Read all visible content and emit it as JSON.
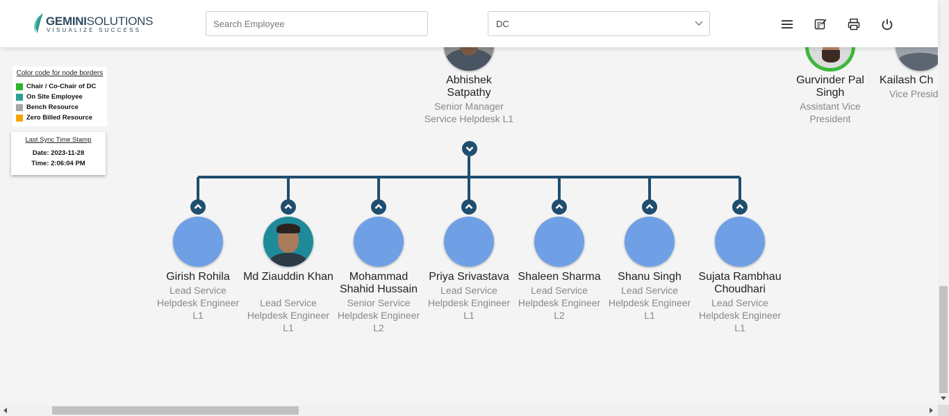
{
  "header": {
    "logo_brand": "GEMINI",
    "logo_suffix": "SOLUTIONS",
    "logo_tagline": "VISUALIZE SUCCESS",
    "search_placeholder": "Search Employee",
    "department_value": "DC",
    "icons": [
      "menu-icon",
      "notes-icon",
      "print-icon",
      "power-icon"
    ]
  },
  "legend": {
    "title": "Color code for node borders",
    "items": [
      {
        "label": "Chair / Co-Chair of DC",
        "color": "#2db52d"
      },
      {
        "label": "On Site Employee",
        "color": "#2f9f9a"
      },
      {
        "label": "Bench Resource",
        "color": "#a6a6a6"
      },
      {
        "label": "Zero Billed Resource",
        "color": "#f5a300"
      }
    ]
  },
  "sync": {
    "title": "Last Sync Time Stamp",
    "date": "Date: 2023-11-28",
    "time": "Time: 2:06:04 PM"
  },
  "org": {
    "colors": {
      "connector": "#1f4e6e",
      "avatar_default": "#6fa0e6",
      "chair_border": "#3cb83c"
    },
    "top_nodes": [
      {
        "name": "Abhishek Satpathy",
        "title": "Senior Manager Service Helpdesk L1"
      },
      {
        "name": "Gurvinder Pal Singh",
        "title": "Assistant Vice President"
      },
      {
        "name": "Kailash Ch",
        "title": "Vice Presid"
      }
    ],
    "children": [
      {
        "name": "Girish Rohila",
        "title": "Lead Service Helpdesk Engineer L1"
      },
      {
        "name": "Md Ziauddin Khan",
        "title": "Lead Service Helpdesk Engineer L1"
      },
      {
        "name": "Mohammad Shahid Hussain",
        "title": "Senior Service Helpdesk Engineer L2"
      },
      {
        "name": "Priya Srivastava",
        "title": "Lead Service Helpdesk Engineer L1"
      },
      {
        "name": "Shaleen Sharma",
        "title": "Lead Service Helpdesk Engineer L2"
      },
      {
        "name": "Shanu Singh",
        "title": "Lead Service Helpdesk Engineer L1"
      },
      {
        "name": "Sujata Rambhau Choudhari",
        "title": "Lead Service Helpdesk Engineer L1"
      }
    ]
  }
}
